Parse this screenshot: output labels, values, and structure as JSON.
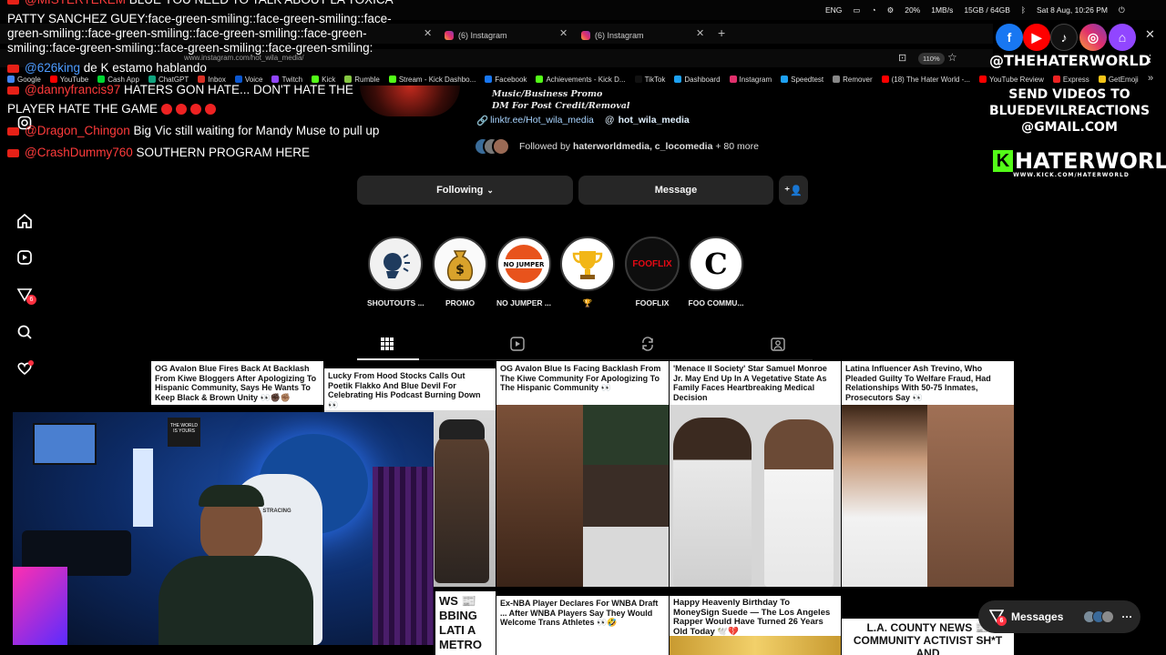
{
  "tray": {
    "lang": "ENG",
    "battery": "20%",
    "net": "1MB/s",
    "storage": "15GB / 64GB",
    "clock": "Sat 8 Aug, 10:26 PM"
  },
  "tabs": [
    {
      "label": "(6) Instagram"
    },
    {
      "label": "(6) Instagram"
    }
  ],
  "address": {
    "url": "www.instagram.com/hot_wila_media/",
    "zoom": "110%"
  },
  "bookmarks": [
    "Google",
    "YouTube",
    "Cash App",
    "ChatGPT",
    "Inbox",
    "Voice",
    "Twitch",
    "Kick",
    "Rumble",
    "Stream - Kick Dashbo...",
    "Facebook",
    "Achievements - Kick D...",
    "TikTok",
    "Dashboard",
    "Instagram",
    "Speedtest",
    "Remover",
    "(18) The Hater World -...",
    "YouTube Review",
    "Express",
    "GetEmoji"
  ],
  "chat": [
    {
      "user": "@MISTERTEKEM",
      "text": "BLUE YOU NEED TO TALK ABOUT LA TOXICA"
    },
    {
      "user": "",
      "text": "PATTY SANCHEZ GUEY:face-green-smiling::face-green-smiling::face-"
    },
    {
      "user": "",
      "text": "green-smiling::face-green-smiling::face-green-smiling::face-green-"
    },
    {
      "user": "",
      "text": "smiling::face-green-smiling::face-green-smiling::face-green-smiling:"
    },
    {
      "user": "@626king",
      "text": "de K estamo hablando"
    },
    {
      "user": "@dannyfrancis97",
      "text": "HATERS GON HATE... DON'T HATE THE"
    },
    {
      "user": "",
      "text": "PLAYER HATE THE GAME"
    },
    {
      "user": "@Dragon_Chingon",
      "text": "Big Vic still waiting for Mandy Muse to pull up"
    },
    {
      "user": "@CrashDummy760",
      "text": "SOUTHERN PROGRAM HERE"
    }
  ],
  "profile": {
    "bio1": "Music/Business Promo",
    "bio2": "DM For Post Credit/Removal",
    "link": "linktr.ee/Hot_wila_media",
    "threads": "hot_wila_media",
    "followed_prefix": "Followed by ",
    "followed_names": "haterworldmedia, c_locomedia",
    "followed_more": " + 80 more",
    "btn_following": "Following",
    "btn_message": "Message"
  },
  "highlights": [
    {
      "label": "SHOUTOUTS ...",
      "glyph": "🗣"
    },
    {
      "label": "PROMO",
      "glyph": "💰"
    },
    {
      "label": "NO JUMPER ...",
      "glyph": "NO JUMPER"
    },
    {
      "label": "🏆",
      "glyph": "🏆"
    },
    {
      "label": "FOOFLIX",
      "glyph": "FOOFLIX"
    },
    {
      "label": "FOO COMMU...",
      "glyph": "C"
    }
  ],
  "posts": [
    {
      "headline": "OG Avalon Blue Fires Back At Backlash From Kiwe Bloggers After Apologizing To Hispanic Community, Says He Wants To Keep Black & Brown Unity 👀✊🏿✊🏽"
    },
    {
      "headline": "Lucky From Hood Stocks Calls Out Poetik Flakko And Blue Devil For Celebrating His Podcast Burning Down 👀"
    },
    {
      "headline": "OG Avalon Blue Is Facing Backlash From The Kiwe Community For Apologizing To The Hispanic Community 👀"
    },
    {
      "headline": "'Menace II Society' Star Samuel Monroe Jr. May End Up In A Vegetative State As Family Faces Heartbreaking Medical Decision"
    },
    {
      "headline": "Latina Influencer Ash Trevino, Who Pleaded Guilty To Welfare Fraud, Had Relationships With 50-75 Inmates, Prosecutors Say 👀"
    },
    {
      "headline": "WS 📰 BBING LATI A METRO"
    },
    {
      "headline": "Ex-NBA Player Declares For WNBA Draft ... After WNBA Players Say They Would Welcome Trans Athletes 👀🤣"
    },
    {
      "headline": "Happy Heavenly Birthday To MoneySign Suede — The Los Angeles Rapper Would Have Turned 26 Years Old Today 🕊️💔"
    },
    {
      "headline": "L.A. COUNTY NEWS 📰 COMMUNITY ACTIVIST SH*T AND"
    }
  ],
  "overlay": {
    "handle": "@THEHATERWORLD",
    "send1": "SEND VIDEOS TO",
    "send2": "BLUEDEVILREACTIONS",
    "send3": "@GMAIL.COM",
    "logo": "HATERWORLD",
    "logo_sub": "WWW.KICK.COM/HATERWORLD"
  },
  "messages": {
    "label": "Messages",
    "badge": "6"
  },
  "sidebar": {
    "notif_badge": "6"
  },
  "cam": {
    "poster": "THE WORLD IS YOURS",
    "chair": "STRACING"
  }
}
